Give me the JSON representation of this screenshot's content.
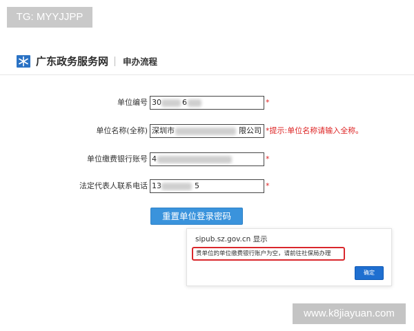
{
  "watermarks": {
    "top": "TG: MYYJJPP",
    "bottom": "www.k8jiayuan.com"
  },
  "header": {
    "site_title": "广东政务服务网",
    "subtitle": "申办流程",
    "logo_icon": "snowflake-logo-icon"
  },
  "form": {
    "fields": [
      {
        "label": "单位编号",
        "value_prefix": "30",
        "value_suffix": "6",
        "required_mark": "*"
      },
      {
        "label": "单位名称(全称)",
        "value_prefix": "深圳市",
        "value_suffix": "限公司",
        "hint": "*提示:单位名称请输入全称。"
      },
      {
        "label": "单位缴费银行账号",
        "value_prefix": "4",
        "value_suffix": "",
        "required_mark": "*"
      },
      {
        "label": "法定代表人联系电话",
        "value_prefix": "13",
        "value_suffix": "5",
        "required_mark": "*"
      }
    ],
    "submit_label": "重置单位登录密码"
  },
  "dialog": {
    "title": "sipub.sz.gov.cn 显示",
    "message": "贵单位的单位缴费银行账户为空，请前往社保局办理",
    "ok_label": "确定"
  },
  "colors": {
    "accent": "#3a93dc",
    "error": "#d22222",
    "dialog_button": "#1f6fd0"
  }
}
